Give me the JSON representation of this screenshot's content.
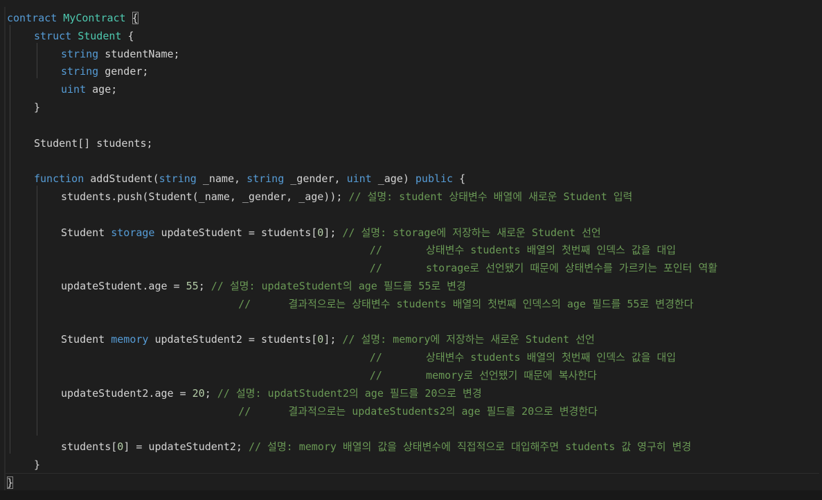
{
  "editor": {
    "language": "solidity",
    "theme_colors": {
      "background": "#1e1e1e",
      "keyword": "#569cd6",
      "type": "#4ec9b0",
      "function": "#dcdcaa",
      "variable": "#9cdcfe",
      "comment": "#6a9955",
      "number": "#b5cea8",
      "text": "#d4d4d4"
    },
    "lines": [
      {
        "indent": 0,
        "tokens": [
          [
            "kw",
            "contract "
          ],
          [
            "ty",
            "MyContract"
          ],
          [
            "plain",
            " "
          ],
          [
            "plain",
            "{"
          ]
        ]
      },
      {
        "indent": 1,
        "tokens": [
          [
            "kw",
            "struct "
          ],
          [
            "ty",
            "Student"
          ],
          [
            "plain",
            " {"
          ]
        ]
      },
      {
        "indent": 2,
        "tokens": [
          [
            "kw",
            "string "
          ],
          [
            "plain",
            "studentName;"
          ]
        ]
      },
      {
        "indent": 2,
        "tokens": [
          [
            "kw",
            "string "
          ],
          [
            "plain",
            "gender;"
          ]
        ]
      },
      {
        "indent": 2,
        "tokens": [
          [
            "kw",
            "uint "
          ],
          [
            "plain",
            "age;"
          ]
        ]
      },
      {
        "indent": 1,
        "tokens": [
          [
            "plain",
            "}"
          ]
        ]
      },
      {
        "indent": 0,
        "tokens": []
      },
      {
        "indent": 1,
        "tokens": [
          [
            "plain",
            "Student[] students;"
          ]
        ]
      },
      {
        "indent": 0,
        "tokens": []
      },
      {
        "indent": 1,
        "tokens": [
          [
            "kw",
            "function "
          ],
          [
            "plain",
            "addStudent("
          ],
          [
            "kw",
            "string "
          ],
          [
            "plain",
            "_name, "
          ],
          [
            "kw",
            "string "
          ],
          [
            "plain",
            "_gender, "
          ],
          [
            "kw",
            "uint "
          ],
          [
            "plain",
            "_age) "
          ],
          [
            "kw",
            "public "
          ],
          [
            "plain",
            "{"
          ]
        ]
      },
      {
        "indent": 2,
        "tokens": [
          [
            "plain",
            "students.push(Student(_name, _gender, _age)); "
          ],
          [
            "cmt",
            "// 설명: student 상태변수 배열에 새로운 Student 입력"
          ]
        ]
      },
      {
        "indent": 0,
        "tokens": []
      },
      {
        "indent": 2,
        "tokens": [
          [
            "plain",
            "Student "
          ],
          [
            "kw",
            "storage "
          ],
          [
            "plain",
            "updateStudent = students["
          ],
          [
            "num",
            "0"
          ],
          [
            "plain",
            "]; "
          ],
          [
            "cmt",
            "// 설명: storage에 저장하는 새로운 Student 선언"
          ]
        ]
      },
      {
        "indent": 0,
        "tokens": [
          [
            "cmt",
            "                                                          //       상태변수 students 배열의 첫번째 인덱스 값을 대입"
          ]
        ]
      },
      {
        "indent": 0,
        "tokens": [
          [
            "cmt",
            "                                                          //       storage로 선언됐기 때문에 상태변수를 가르키는 포인터 역활"
          ]
        ]
      },
      {
        "indent": 2,
        "tokens": [
          [
            "plain",
            "updateStudent.age = "
          ],
          [
            "num",
            "55"
          ],
          [
            "plain",
            "; "
          ],
          [
            "cmt",
            "// 설명: updateStudent의 age 필드를 55로 변경"
          ]
        ]
      },
      {
        "indent": 0,
        "tokens": [
          [
            "cmt",
            "                                     //      결과적으로는 상태변수 students 배열의 첫번째 인덱스의 age 필드를 55로 변경한다"
          ]
        ]
      },
      {
        "indent": 0,
        "tokens": []
      },
      {
        "indent": 2,
        "tokens": [
          [
            "plain",
            "Student "
          ],
          [
            "kw",
            "memory "
          ],
          [
            "plain",
            "updateStudent2 = students["
          ],
          [
            "num",
            "0"
          ],
          [
            "plain",
            "]; "
          ],
          [
            "cmt",
            "// 설명: memory에 저장하는 새로운 Student 선언"
          ]
        ]
      },
      {
        "indent": 0,
        "tokens": [
          [
            "cmt",
            "                                                          //       상태변수 students 배열의 첫번째 인덱스 값을 대입"
          ]
        ]
      },
      {
        "indent": 0,
        "tokens": [
          [
            "cmt",
            "                                                          //       memory로 선언됐기 때문에 복사한다"
          ]
        ]
      },
      {
        "indent": 2,
        "tokens": [
          [
            "plain",
            "updateStudent2.age = "
          ],
          [
            "num",
            "20"
          ],
          [
            "plain",
            "; "
          ],
          [
            "cmt",
            "// 설명: updatStudent2의 age 필드를 20으로 변경"
          ]
        ]
      },
      {
        "indent": 0,
        "tokens": [
          [
            "cmt",
            "                                     //      결과적으로는 updateStudents2의 age 필드를 20으로 변경한다"
          ]
        ]
      },
      {
        "indent": 0,
        "tokens": []
      },
      {
        "indent": 2,
        "tokens": [
          [
            "plain",
            "students["
          ],
          [
            "num",
            "0"
          ],
          [
            "plain",
            "] = updateStudent2; "
          ],
          [
            "cmt",
            "// 설명: memory 배열의 값을 상태변수에 직접적으로 대입해주면 students 값 영구히 변경"
          ]
        ]
      },
      {
        "indent": 1,
        "tokens": [
          [
            "plain",
            "}"
          ]
        ]
      },
      {
        "indent": 0,
        "tokens": [
          [
            "plain",
            "}"
          ]
        ]
      }
    ]
  }
}
